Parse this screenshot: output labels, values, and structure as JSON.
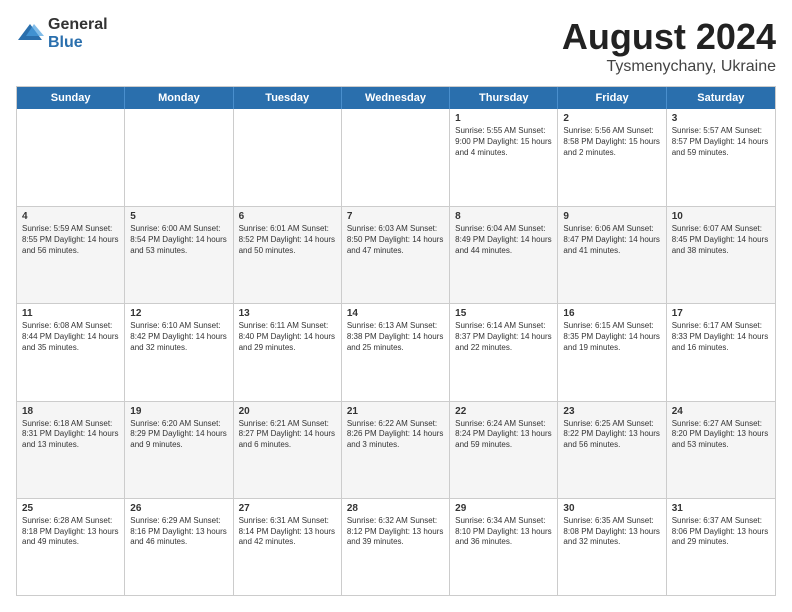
{
  "logo": {
    "general": "General",
    "blue": "Blue"
  },
  "title": {
    "month_year": "August 2024",
    "location": "Tysmenychany, Ukraine"
  },
  "weekdays": [
    "Sunday",
    "Monday",
    "Tuesday",
    "Wednesday",
    "Thursday",
    "Friday",
    "Saturday"
  ],
  "rows": [
    {
      "alt": false,
      "cells": [
        {
          "date": "",
          "content": ""
        },
        {
          "date": "",
          "content": ""
        },
        {
          "date": "",
          "content": ""
        },
        {
          "date": "",
          "content": ""
        },
        {
          "date": "1",
          "content": "Sunrise: 5:55 AM\nSunset: 9:00 PM\nDaylight: 15 hours\nand 4 minutes."
        },
        {
          "date": "2",
          "content": "Sunrise: 5:56 AM\nSunset: 8:58 PM\nDaylight: 15 hours\nand 2 minutes."
        },
        {
          "date": "3",
          "content": "Sunrise: 5:57 AM\nSunset: 8:57 PM\nDaylight: 14 hours\nand 59 minutes."
        }
      ]
    },
    {
      "alt": true,
      "cells": [
        {
          "date": "4",
          "content": "Sunrise: 5:59 AM\nSunset: 8:55 PM\nDaylight: 14 hours\nand 56 minutes."
        },
        {
          "date": "5",
          "content": "Sunrise: 6:00 AM\nSunset: 8:54 PM\nDaylight: 14 hours\nand 53 minutes."
        },
        {
          "date": "6",
          "content": "Sunrise: 6:01 AM\nSunset: 8:52 PM\nDaylight: 14 hours\nand 50 minutes."
        },
        {
          "date": "7",
          "content": "Sunrise: 6:03 AM\nSunset: 8:50 PM\nDaylight: 14 hours\nand 47 minutes."
        },
        {
          "date": "8",
          "content": "Sunrise: 6:04 AM\nSunset: 8:49 PM\nDaylight: 14 hours\nand 44 minutes."
        },
        {
          "date": "9",
          "content": "Sunrise: 6:06 AM\nSunset: 8:47 PM\nDaylight: 14 hours\nand 41 minutes."
        },
        {
          "date": "10",
          "content": "Sunrise: 6:07 AM\nSunset: 8:45 PM\nDaylight: 14 hours\nand 38 minutes."
        }
      ]
    },
    {
      "alt": false,
      "cells": [
        {
          "date": "11",
          "content": "Sunrise: 6:08 AM\nSunset: 8:44 PM\nDaylight: 14 hours\nand 35 minutes."
        },
        {
          "date": "12",
          "content": "Sunrise: 6:10 AM\nSunset: 8:42 PM\nDaylight: 14 hours\nand 32 minutes."
        },
        {
          "date": "13",
          "content": "Sunrise: 6:11 AM\nSunset: 8:40 PM\nDaylight: 14 hours\nand 29 minutes."
        },
        {
          "date": "14",
          "content": "Sunrise: 6:13 AM\nSunset: 8:38 PM\nDaylight: 14 hours\nand 25 minutes."
        },
        {
          "date": "15",
          "content": "Sunrise: 6:14 AM\nSunset: 8:37 PM\nDaylight: 14 hours\nand 22 minutes."
        },
        {
          "date": "16",
          "content": "Sunrise: 6:15 AM\nSunset: 8:35 PM\nDaylight: 14 hours\nand 19 minutes."
        },
        {
          "date": "17",
          "content": "Sunrise: 6:17 AM\nSunset: 8:33 PM\nDaylight: 14 hours\nand 16 minutes."
        }
      ]
    },
    {
      "alt": true,
      "cells": [
        {
          "date": "18",
          "content": "Sunrise: 6:18 AM\nSunset: 8:31 PM\nDaylight: 14 hours\nand 13 minutes."
        },
        {
          "date": "19",
          "content": "Sunrise: 6:20 AM\nSunset: 8:29 PM\nDaylight: 14 hours\nand 9 minutes."
        },
        {
          "date": "20",
          "content": "Sunrise: 6:21 AM\nSunset: 8:27 PM\nDaylight: 14 hours\nand 6 minutes."
        },
        {
          "date": "21",
          "content": "Sunrise: 6:22 AM\nSunset: 8:26 PM\nDaylight: 14 hours\nand 3 minutes."
        },
        {
          "date": "22",
          "content": "Sunrise: 6:24 AM\nSunset: 8:24 PM\nDaylight: 13 hours\nand 59 minutes."
        },
        {
          "date": "23",
          "content": "Sunrise: 6:25 AM\nSunset: 8:22 PM\nDaylight: 13 hours\nand 56 minutes."
        },
        {
          "date": "24",
          "content": "Sunrise: 6:27 AM\nSunset: 8:20 PM\nDaylight: 13 hours\nand 53 minutes."
        }
      ]
    },
    {
      "alt": false,
      "cells": [
        {
          "date": "25",
          "content": "Sunrise: 6:28 AM\nSunset: 8:18 PM\nDaylight: 13 hours\nand 49 minutes."
        },
        {
          "date": "26",
          "content": "Sunrise: 6:29 AM\nSunset: 8:16 PM\nDaylight: 13 hours\nand 46 minutes."
        },
        {
          "date": "27",
          "content": "Sunrise: 6:31 AM\nSunset: 8:14 PM\nDaylight: 13 hours\nand 42 minutes."
        },
        {
          "date": "28",
          "content": "Sunrise: 6:32 AM\nSunset: 8:12 PM\nDaylight: 13 hours\nand 39 minutes."
        },
        {
          "date": "29",
          "content": "Sunrise: 6:34 AM\nSunset: 8:10 PM\nDaylight: 13 hours\nand 36 minutes."
        },
        {
          "date": "30",
          "content": "Sunrise: 6:35 AM\nSunset: 8:08 PM\nDaylight: 13 hours\nand 32 minutes."
        },
        {
          "date": "31",
          "content": "Sunrise: 6:37 AM\nSunset: 8:06 PM\nDaylight: 13 hours\nand 29 minutes."
        }
      ]
    }
  ]
}
